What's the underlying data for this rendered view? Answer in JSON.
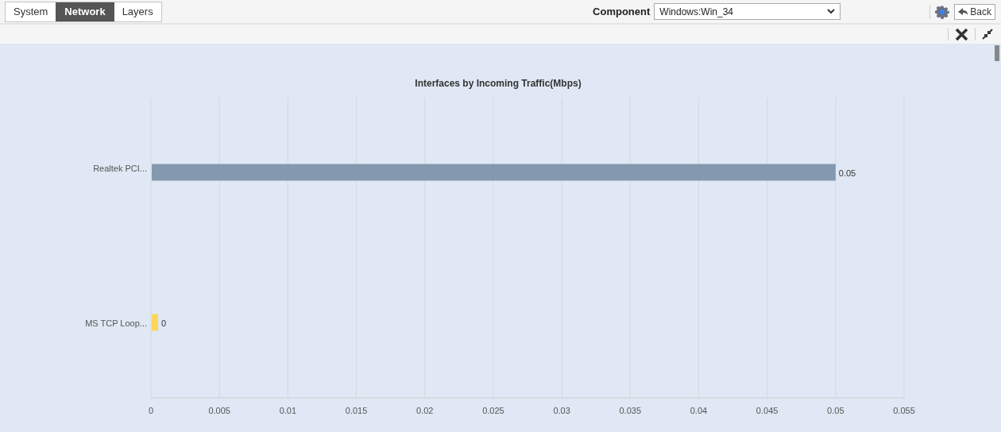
{
  "tabs": [
    {
      "label": "System",
      "selected": false
    },
    {
      "label": "Network",
      "selected": true
    },
    {
      "label": "Layers",
      "selected": false
    }
  ],
  "component": {
    "label": "Component",
    "value": "Windows:Win_34"
  },
  "back_button": "Back",
  "chart": {
    "chart_data": {
      "type": "bar",
      "orientation": "horizontal",
      "title": "Interfaces by Incoming Traffic(Mbps)",
      "categories": [
        "Realtek PCI...",
        "MS TCP Loop..."
      ],
      "series": [
        {
          "color": "#8499b0",
          "values": [
            0.05,
            null
          ]
        },
        {
          "color": "#ffd65c",
          "values": [
            null,
            0
          ]
        }
      ],
      "xlim": [
        0,
        0.055
      ],
      "xticks": [
        0,
        0.005,
        0.01,
        0.015,
        0.02,
        0.025,
        0.03,
        0.035,
        0.04,
        0.045,
        0.05,
        0.055
      ],
      "grid": true,
      "data_labels": true
    }
  }
}
